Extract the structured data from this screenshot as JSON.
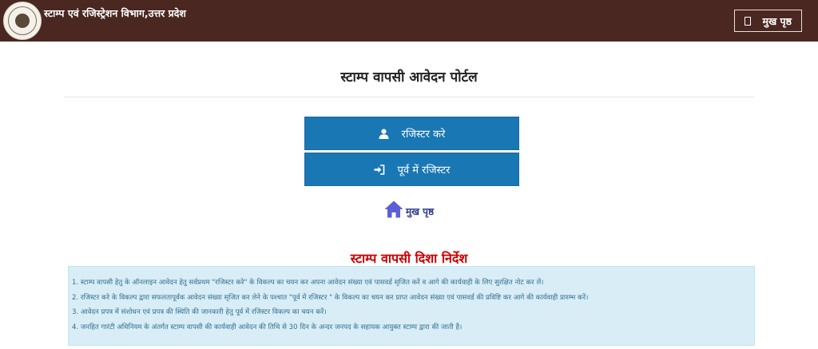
{
  "header": {
    "title": "स्टाम्प एवं रजिस्ट्रेशन विभाग,उत्तर प्रदेश",
    "home_label": "मुख पृष्ठ",
    "home_icon": "square-icon"
  },
  "main": {
    "title": "स्टाम्प वापसी आवेदन पोर्टल",
    "register_label": "रजिस्टर करे",
    "register_icon": "user-icon",
    "login_label": "पूर्व में रजिस्टर",
    "login_icon": "sign-in-icon",
    "home_link_label": "मुख पृष्ठ",
    "home_link_icon": "house-icon"
  },
  "guidelines": {
    "title": "स्टाम्प वापसी दिशा निर्देश",
    "items": [
      "1. स्टाम्प वापसी हेतु के ऑनलाइन आवेदन हेतु सर्वप्रथम \"रजिस्टर करे\" के विकल्प का चयन कर अपना आवेदन संख्या एवं पासवर्ड सृजित करें व आगे की कार्यवाही के लिए सुरक्षित नोट कर लें।",
      "2. रजिस्टर करे के विकल्प द्वारा सफलतापूर्वक आवेदन संख्या सृजित कर लेने के पश्चात \"पूर्व में रजिस्टर \" के विकल्प का चयन कर प्राप्त आवेदन संख्या एवं पासवर्ड की प्रविष्टि कर आगे की कार्यवाही प्रारम्भ करें।",
      "3. आवेदन प्रपत्र में संशोधन एवं प्रपत्र की स्थिति की जानकारी हेतु पूर्व में रजिस्टर विकल्प का चयन करें।",
      "4. जनहित गारंटी अधिनियम के अंतर्गत स्टाम्प वापसी की कार्यवाही आवेदन की तिथि से 30 दिन के अन्दर जनपद के सहायक आयुक्त स्टाम्प द्वारा की जाती है।"
    ]
  },
  "colors": {
    "header_bg": "#4a2720",
    "button_bg": "#1977b4",
    "guide_title": "#cc0000",
    "guide_box_bg": "#d9edf7",
    "guide_text": "#31708f",
    "home_icon": "#5b5fd6"
  }
}
